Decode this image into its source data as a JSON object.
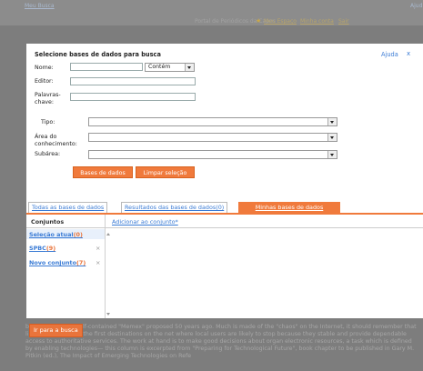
{
  "background": {
    "top_link": "Meu Busca",
    "top_right_link": "Ajud",
    "portal_title": "Portal de Periódicos da Capes",
    "nav": [
      "Meu Espaço",
      "Minha conta",
      "Sair"
    ],
    "bottom_button": "Ir para a busca",
    "bottom_text": "bottom text from self-contained \"Memex\" proposed 50 years ago. Much is made of the \"chaos\" on the Internet, it should remember that libraries are among the first destinations on the net where local users are likely to stop because they stable and provide dependable access to authoritative services. The work at hand is to make good decisions about organ electronic resources, a task which is defined by enabling technologies— this column is excerpted from \"Preparing for Technological Future\", book chapter to be published in Gary M. Pitkin (ed.), The Impact of Emerging Technologies on Refe"
  },
  "modal": {
    "title": "Selecione bases de dados para busca",
    "help": "Ajuda",
    "close": "x",
    "fields": {
      "nome_label": "Nome:",
      "nome_value": "",
      "match_option": "Contém",
      "editor_label": "Editor:",
      "editor_value": "",
      "palavras_label": "Palavras-chave:",
      "palavras_value": "",
      "tipo_label": "Tipo:",
      "tipo_value": "",
      "area_label": "Área do conhecimento:",
      "area_value": "",
      "subarea_label": "Subárea:",
      "subarea_value": ""
    },
    "buttons": {
      "bases": "Bases de dados",
      "limpar": "Limpar seleção"
    },
    "tabs": [
      "Todas as bases de dados",
      "Resultados das bases de dados(0)",
      "Minhas bases de dados"
    ],
    "sets": {
      "header": "Conjuntos",
      "add_link": "Adicionar ao conjunto*",
      "items": [
        {
          "label": "Seleção atual",
          "count": "(0)"
        },
        {
          "label": "SPBC",
          "count": "(9)"
        },
        {
          "label": "Novo conjunto",
          "count": "(7)"
        }
      ],
      "remove": "×"
    }
  }
}
